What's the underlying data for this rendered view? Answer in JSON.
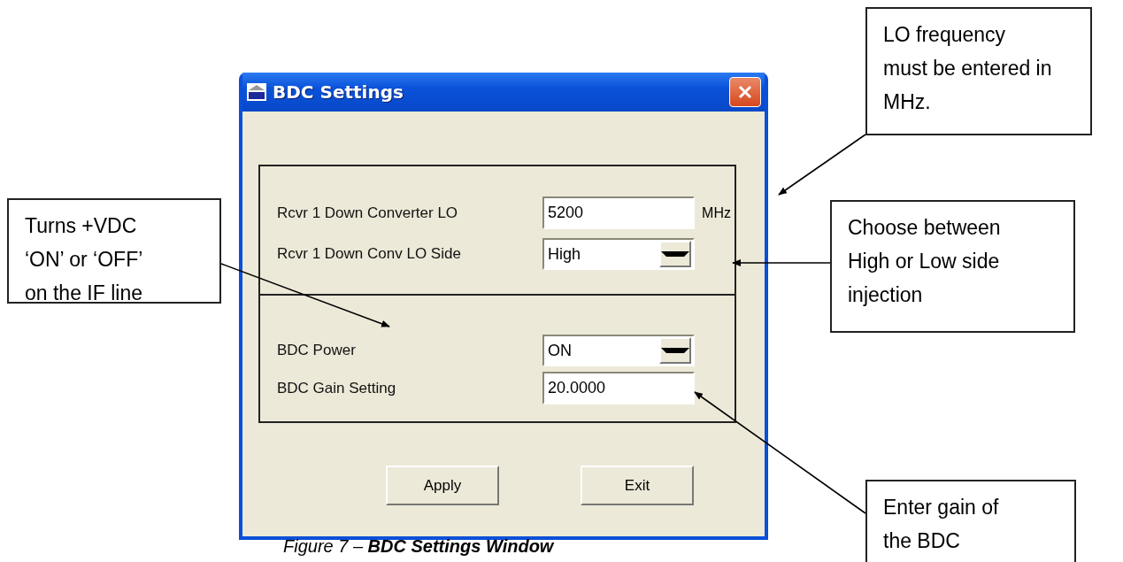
{
  "dialog": {
    "title": "BDC Settings",
    "sections": [
      [
        {
          "kind": "text",
          "label": "Rcvr 1 Down Converter LO",
          "value": "5200",
          "unit": "MHz"
        },
        {
          "kind": "dropdown",
          "label": "Rcvr 1 Down Conv LO Side",
          "value": "High"
        }
      ],
      [
        {
          "kind": "dropdown",
          "label": "BDC Power",
          "value": "ON"
        },
        {
          "kind": "text",
          "label": "BDC Gain Setting",
          "value": "20.0000"
        }
      ]
    ],
    "buttons": [
      "Apply",
      "Exit"
    ]
  },
  "callouts": [
    {
      "lines": [
        "LO frequency",
        "must be entered in",
        "MHz."
      ]
    },
    {
      "lines": [
        "Turns +VDC",
        "‘ON’ or ‘OFF’",
        "on the IF line"
      ]
    },
    {
      "lines": [
        "Choose between",
        "High or Low side",
        "injection"
      ]
    },
    {
      "lines": [
        "Enter gain of",
        "the BDC"
      ]
    }
  ],
  "caption": "Figure 7 – **BDC Settings Window**"
}
